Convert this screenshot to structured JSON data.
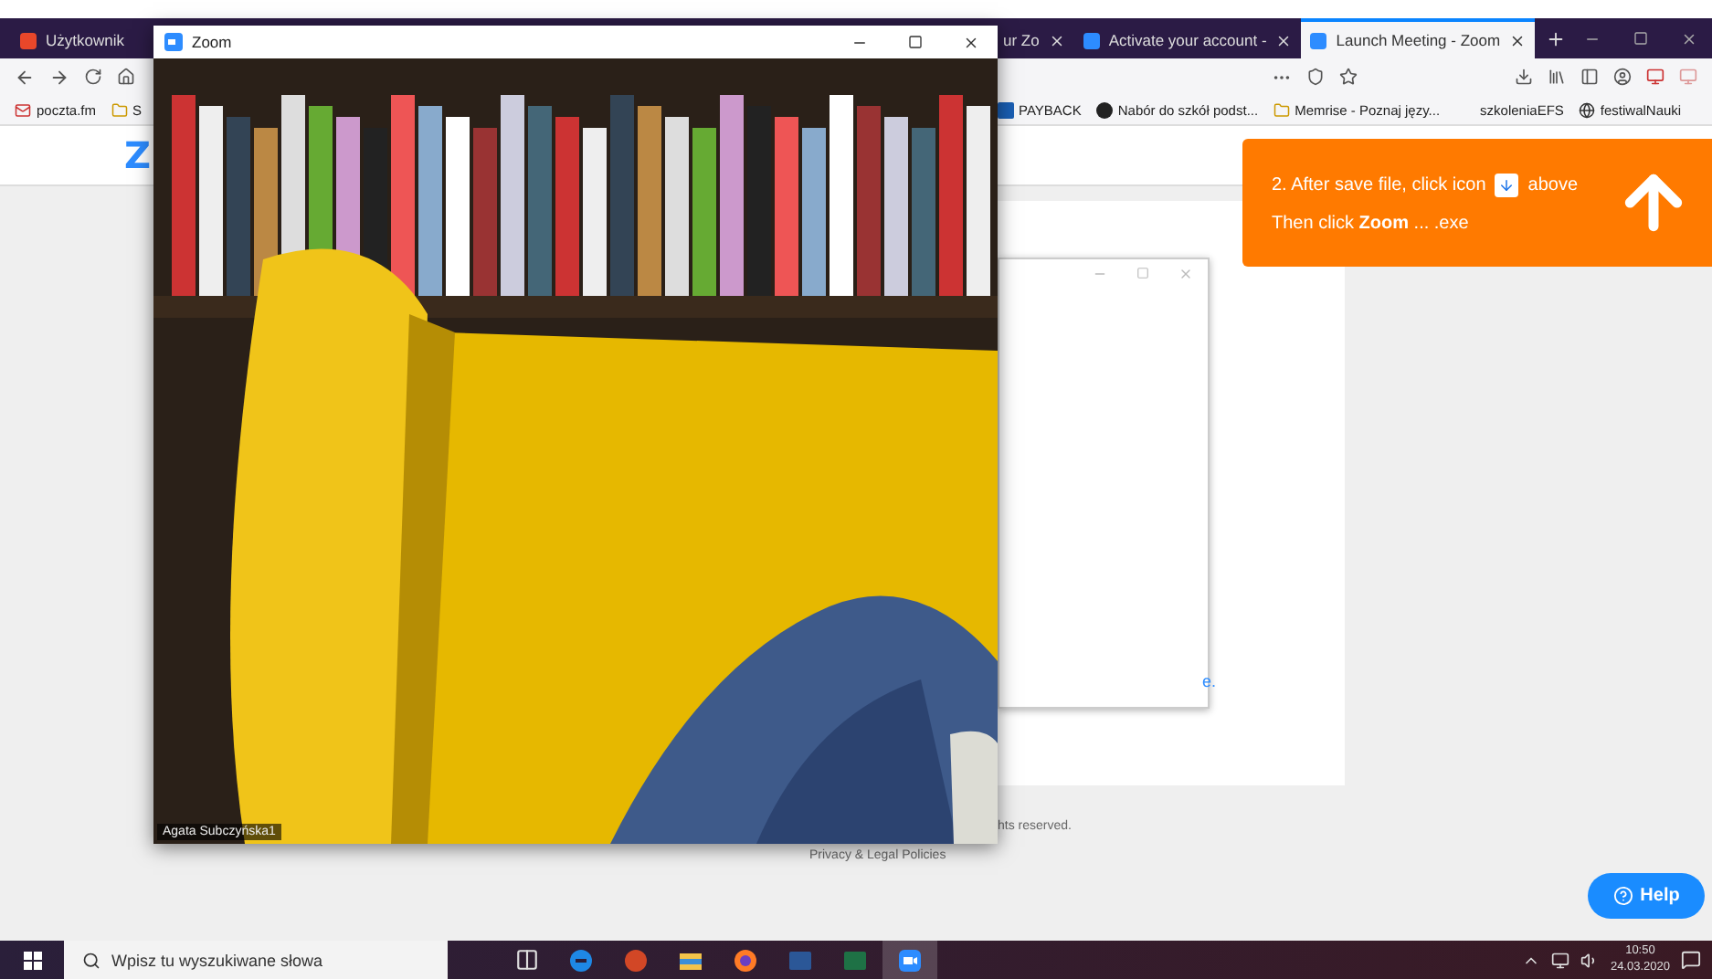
{
  "browser": {
    "tabs": [
      {
        "label": "Użytkownik",
        "selected": false,
        "closable": false,
        "color": "#e8472a"
      },
      {
        "label": "ur Zo",
        "selected": false,
        "closable": true
      },
      {
        "label": "Activate your account -",
        "selected": false,
        "closable": true,
        "color": "#2d8cff"
      },
      {
        "label": "Launch Meeting - Zoom",
        "selected": true,
        "closable": true,
        "color": "#2d8cff"
      }
    ],
    "bookmarks_left": [
      {
        "label": "poczta.fm",
        "kind": "mail"
      },
      {
        "label": "S",
        "kind": "folder"
      }
    ],
    "bookmarks_right": [
      {
        "label": "PAYBACK",
        "kind": "square"
      },
      {
        "label": "Nabór do szkół podst...",
        "kind": "circle"
      },
      {
        "label": "Memrise - Poznaj języ...",
        "kind": "folder"
      },
      {
        "label": "szkoleniaEFS",
        "kind": "none"
      },
      {
        "label": "festiwalNauki",
        "kind": "globe"
      }
    ]
  },
  "page": {
    "logo": "Z",
    "banner": {
      "line1_start": "2. After save file, click icon",
      "line1_end": "above",
      "line2": "Then click **Zoom** ... .exe"
    },
    "link_fragment": "e.",
    "footer_rights": "hts reserved.",
    "footer_link": "Privacy & Legal Policies",
    "help_button": "Help"
  },
  "zoom_window": {
    "title": "Zoom",
    "participant": "Agata Subczyńska1"
  },
  "taskbar": {
    "search_placeholder": "Wpisz tu wyszukiwane słowa",
    "apps": [
      {
        "kind": "taskview",
        "active": false
      },
      {
        "kind": "edge",
        "active": false
      },
      {
        "kind": "powerpoint",
        "active": false
      },
      {
        "kind": "explorer",
        "active": false
      },
      {
        "kind": "firefox",
        "active": false
      },
      {
        "kind": "word",
        "active": false
      },
      {
        "kind": "excel",
        "active": false
      },
      {
        "kind": "zoom",
        "active": true
      }
    ],
    "time": "10:50",
    "date": "24.03.2020"
  }
}
